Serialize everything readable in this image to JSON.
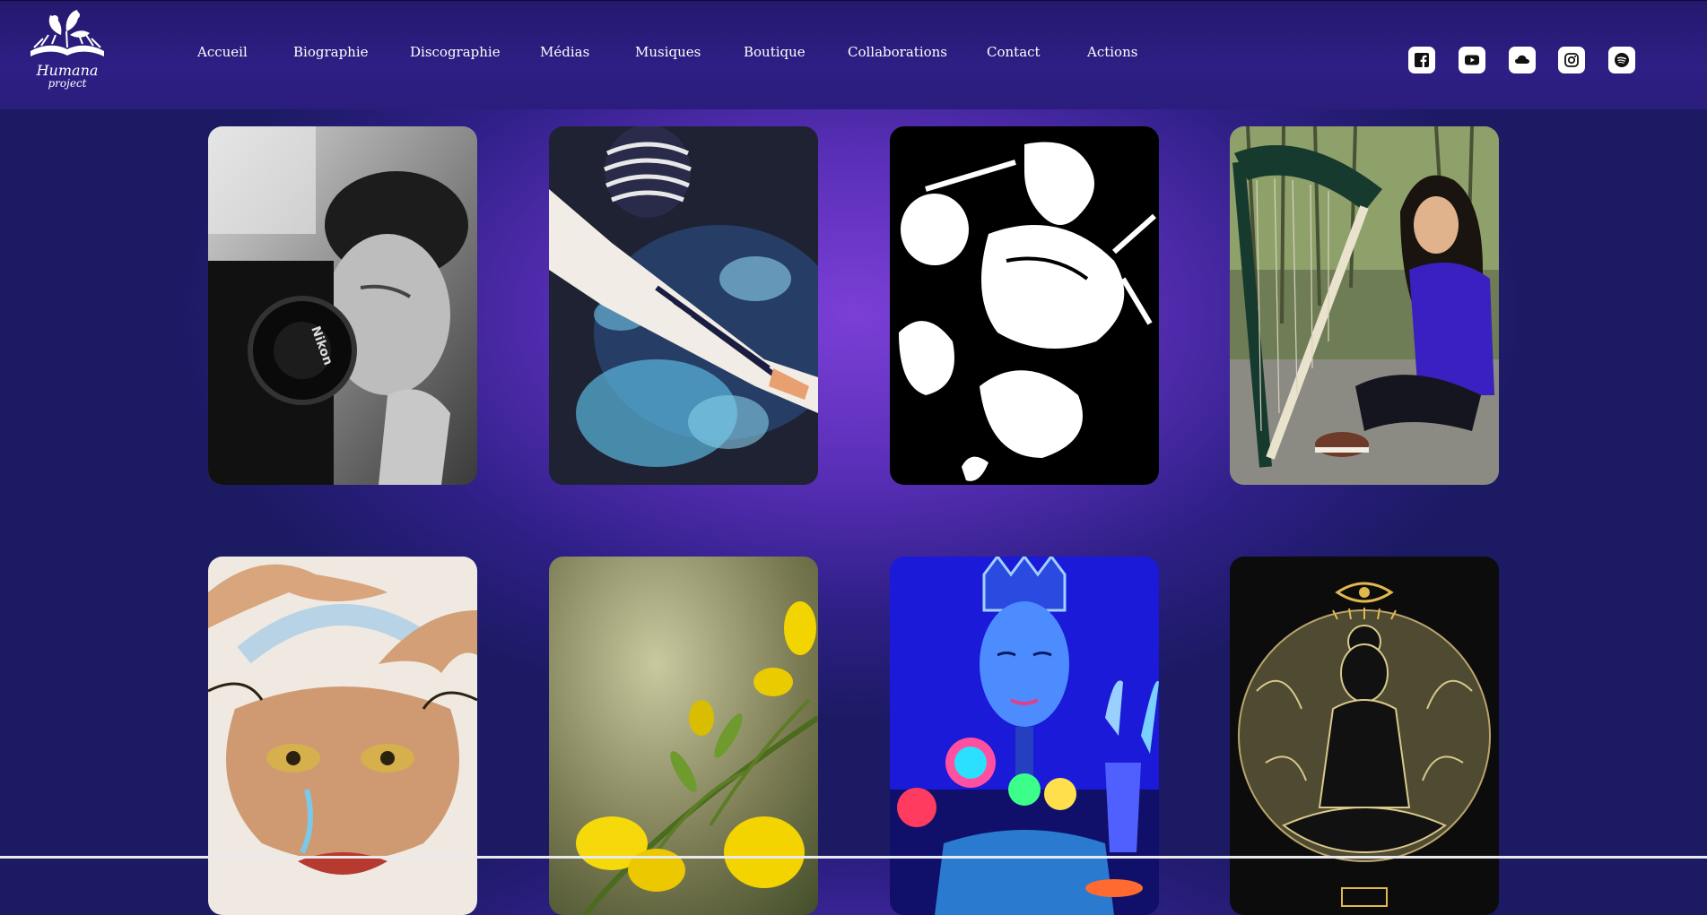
{
  "brand": {
    "name": "Humana",
    "sub": "project"
  },
  "nav": [
    {
      "label": "Accueil"
    },
    {
      "label": "Biographie"
    },
    {
      "label": "Discographie"
    },
    {
      "label": "Médias"
    },
    {
      "label": "Musiques"
    },
    {
      "label": "Boutique"
    },
    {
      "label": "Collaborations"
    },
    {
      "label": "Contact"
    },
    {
      "label": "Actions"
    }
  ],
  "socials": [
    {
      "icon": "facebook-icon"
    },
    {
      "icon": "youtube-icon"
    },
    {
      "icon": "soundcloud-icon"
    },
    {
      "icon": "instagram-icon"
    },
    {
      "icon": "spotify-icon"
    }
  ],
  "gallery": [
    {
      "subject": "black-and-white photo of person filming with a Nikon camera",
      "text": "Nikon"
    },
    {
      "subject": "child in striped beanie reaching over blue water painting"
    },
    {
      "subject": "black and white illustration of falling animals"
    },
    {
      "subject": "woman in purple sweater sitting next to a harp"
    },
    {
      "subject": "ink and watercolour drawing of a crab-like face"
    },
    {
      "subject": "close-up of yellow broom flowers"
    },
    {
      "subject": "blue masks under UV light"
    },
    {
      "subject": "gold line art of meditating woman with eye symbol"
    }
  ],
  "colors": {
    "header": "#2a1d7d",
    "background_center": "#7b3fd6",
    "background_edge": "#1b1a62"
  }
}
